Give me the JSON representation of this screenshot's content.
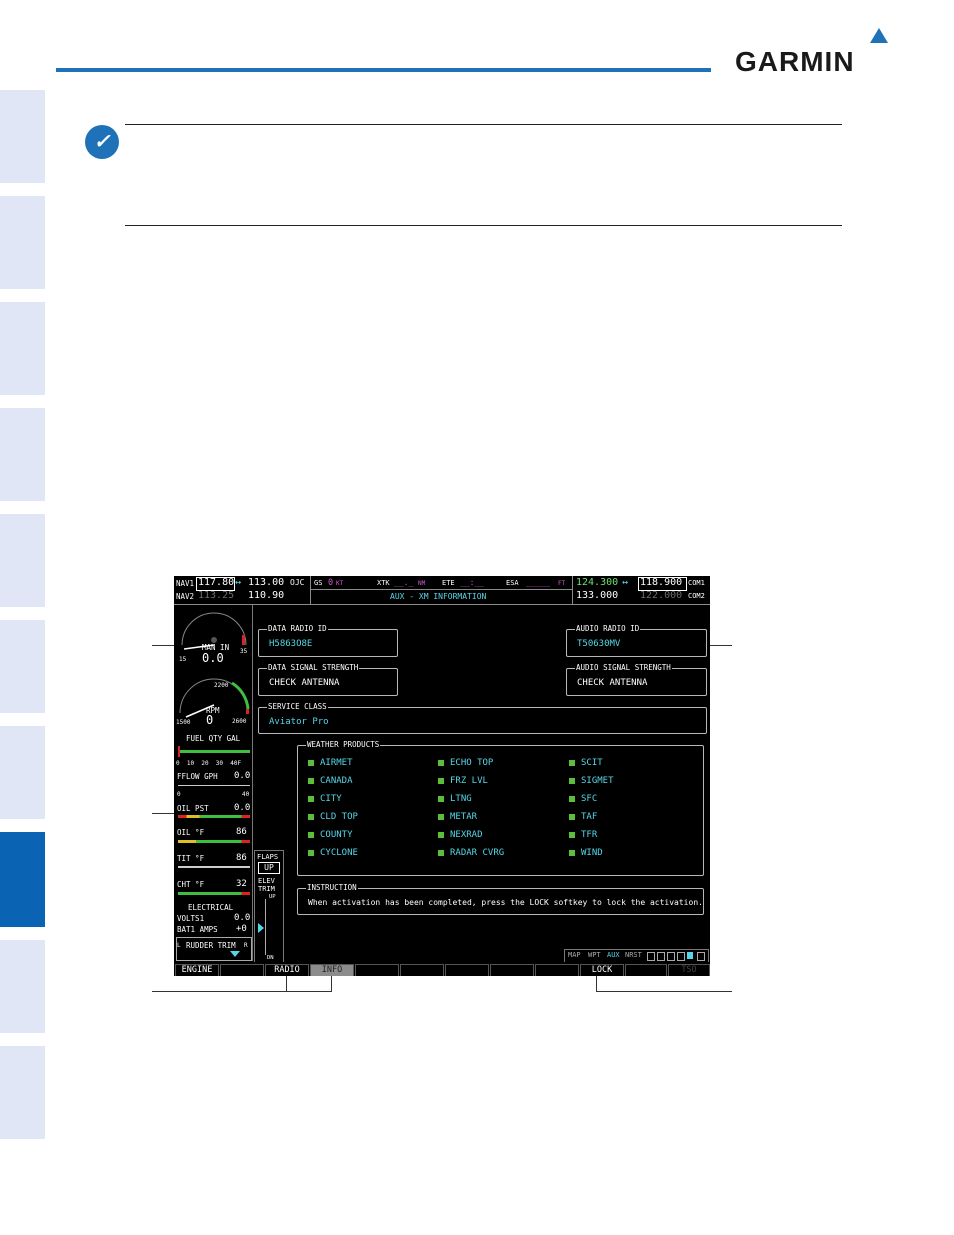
{
  "brand": {
    "name": "GARMIN"
  },
  "nav": {
    "nav1_label": "NAV1",
    "nav1_active": "117.80",
    "nav1_arrow": "↔",
    "nav1_standby": "113.00",
    "nav1_ident": "OJC",
    "nav2_label": "NAV2",
    "nav2_active": "113.25",
    "nav2_standby": "110.90"
  },
  "fields": {
    "gs_label": "GS",
    "gs_value": "0",
    "gs_unit": "KT",
    "xtk_label": "XTK",
    "xtk_value": "__._",
    "xtk_unit": "NM",
    "ete_label": "ETE",
    "ete_value": "__:__",
    "esa_label": "ESA",
    "esa_value": "_____",
    "esa_unit": "FT"
  },
  "page_title": "AUX - XM INFORMATION",
  "com": {
    "com1_active": "124.300",
    "com1_arrow": "↔",
    "com1_standby": "118.900",
    "com1_label": "COM1",
    "com2_active": "133.000",
    "com2_standby": "122.000",
    "com2_label": "COM2"
  },
  "data_radio": {
    "label": "DATA RADIO ID",
    "value": "H5863O8E"
  },
  "audio_radio": {
    "label": "AUDIO RADIO ID",
    "value": "T50630MV"
  },
  "data_signal": {
    "label": "DATA SIGNAL STRENGTH",
    "value": "CHECK ANTENNA"
  },
  "audio_signal": {
    "label": "AUDIO SIGNAL STRENGTH",
    "value": "CHECK ANTENNA"
  },
  "service_class": {
    "label": "SERVICE CLASS",
    "value": "Aviator Pro"
  },
  "weather": {
    "label": "WEATHER PRODUCTS",
    "col1": [
      "AIRMET",
      "CANADA",
      "CITY",
      "CLD TOP",
      "COUNTY",
      "CYCLONE"
    ],
    "col2": [
      "ECHO TOP",
      "FRZ LVL",
      "LTNG",
      "METAR",
      "NEXRAD",
      "RADAR CVRG"
    ],
    "col3": [
      "SCIT",
      "SIGMET",
      "SFC",
      "TAF",
      "TFR",
      "WIND"
    ]
  },
  "instruction": {
    "label": "INSTRUCTION",
    "text": "When activation has been completed, press the LOCK softkey to lock the activation."
  },
  "page_group": {
    "items": [
      "MAP",
      "WPT",
      "AUX",
      "NRST"
    ]
  },
  "eis": {
    "man_in": "MAN IN",
    "man_val": "0.0",
    "man_lo": "15",
    "man_hi": "35",
    "rpm": "RPM",
    "rpm_val": "0",
    "rpm_2200": "2200",
    "rpm_lo": "1500",
    "rpm_hi": "2600",
    "fuel": "FUEL QTY GAL",
    "fuel_scale": [
      "0",
      "10",
      "20",
      "30",
      "40F"
    ],
    "fflow": "FFLOW GPH",
    "fflow_val": "0.0",
    "fflow_lo": "0",
    "fflow_hi": "40",
    "oil_pst": "OIL PST",
    "oil_pst_val": "0.0",
    "oil": "OIL °F",
    "oil_val": "86",
    "tit": "TIT °F",
    "tit_val": "86",
    "cht": "CHT °F",
    "cht_val": "32",
    "electrical": "ELECTRICAL",
    "volts": "VOLTS1",
    "volts_val": "0.0",
    "amps": "BAT1 AMPS",
    "amps_val": "+0",
    "rudder": "RUDDER TRIM",
    "rudder_l": "L",
    "rudder_r": "R",
    "flaps": "FLAPS",
    "flaps_val": "UP",
    "elev": "ELEV",
    "trim": "TRIM",
    "up": "UP",
    "dn": "DN"
  },
  "softkeys": [
    "ENGINE",
    "",
    "RADIO",
    "INFO",
    "",
    "",
    "",
    "",
    "",
    "LOCK",
    "",
    "TSO"
  ]
}
